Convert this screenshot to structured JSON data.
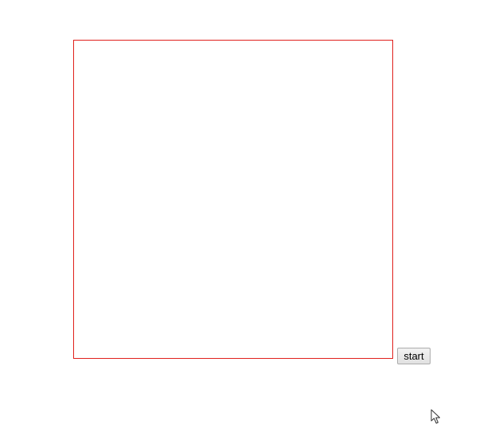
{
  "canvas": {
    "border_color": "#e0201c"
  },
  "controls": {
    "start_label": "start"
  },
  "cursor": {
    "icon": "mouse-pointer-icon"
  }
}
